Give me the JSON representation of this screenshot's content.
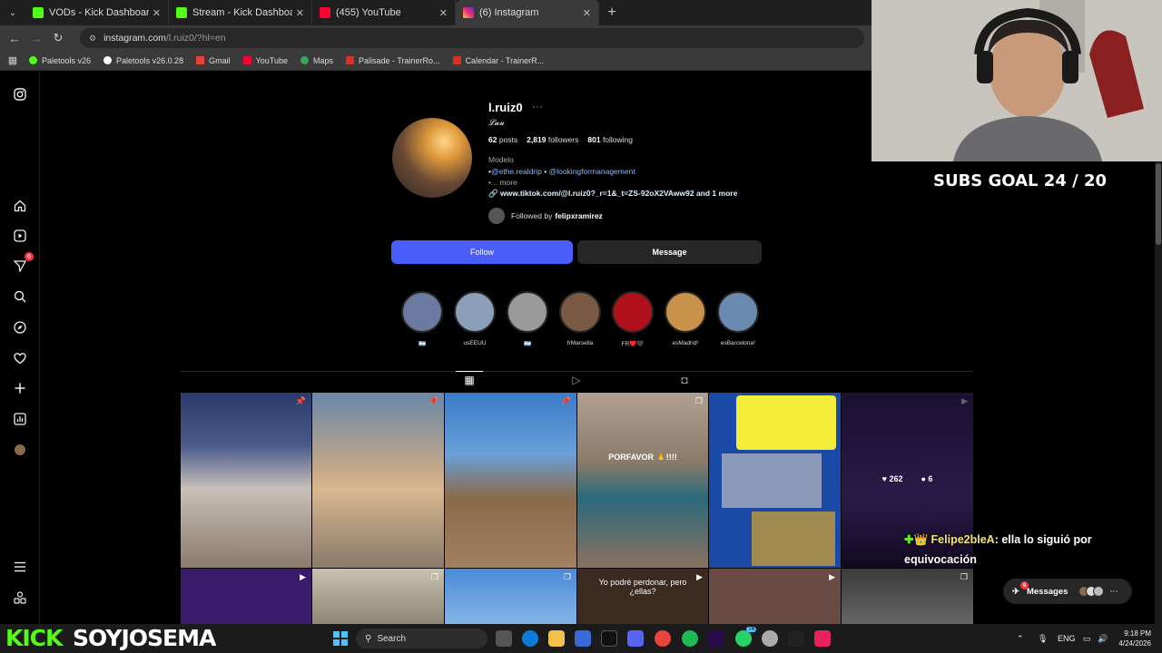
{
  "browser": {
    "tabs": [
      {
        "label": "VODs - Kick Dashboard",
        "icon": "kick"
      },
      {
        "label": "Stream - Kick Dashboard",
        "icon": "kick"
      },
      {
        "label": "(455) YouTube",
        "icon": "yt"
      },
      {
        "label": "(6) Instagram",
        "icon": "ig"
      }
    ],
    "url": {
      "domain": "instagram.com",
      "path": "/l.ruiz0/?hl=en"
    },
    "bookmarks": [
      {
        "label": "Paletools v26",
        "color": "#53fc18"
      },
      {
        "label": "Paletools v26.0.28",
        "color": "#ffffff"
      },
      {
        "label": "Gmail",
        "color": "#ea4335"
      },
      {
        "label": "YouTube",
        "color": "#ff0033"
      },
      {
        "label": "Maps",
        "color": "#34a853"
      },
      {
        "label": "Palisade - TrainerRo...",
        "color": "#d93025"
      },
      {
        "label": "Calendar - TrainerR...",
        "color": "#d93025"
      }
    ]
  },
  "instagram": {
    "sidebar": {
      "notifications_badge": "6"
    },
    "profile": {
      "username": "l.ruiz0",
      "more": "···",
      "full_name": "𝓛𝓪𝓾",
      "stats": {
        "posts": {
          "value": "62",
          "label": "posts"
        },
        "followers": {
          "value": "2,819",
          "label": "followers"
        },
        "following": {
          "value": "801",
          "label": "following"
        }
      },
      "bio_category": "Modelo",
      "bio_tag1": "@ethe.realdrip",
      "bio_tag2": "@lookingformanagement",
      "bio_more": "... more",
      "bio_link": "www.tiktok.com/@l.ruiz0?_r=1&_t=ZS-92oX2VAww92 and 1 more",
      "followed_by_prefix": "Followed by",
      "followed_by_user": "felipxramirez"
    },
    "buttons": {
      "follow": "Follow",
      "message": "Message"
    },
    "highlights": [
      {
        "label": "🇦🇷",
        "color": "#6a7aa0"
      },
      {
        "label": "usEEUU",
        "color": "#8aa0b8"
      },
      {
        "label": "🇦🇷",
        "color": "#9a9a9a"
      },
      {
        "label": "frMarsella",
        "color": "#7a5a44"
      },
      {
        "label": "FR♥️🖤",
        "color": "#b0101a"
      },
      {
        "label": "esMadrid²",
        "color": "#c8924a"
      },
      {
        "label": "esBarcelona²",
        "color": "#6a8ab0"
      }
    ],
    "grid": {
      "caption_porfavor": "PORFAVOR 🙏!!!!",
      "caption_perdonar": "Yo podré perdonar, pero ¿ellas?",
      "likes": "262",
      "comments": "6"
    }
  },
  "overlay": {
    "subs_goal": "SUBS GOAL 24 / 20",
    "chat_user": "Felipe2bleA",
    "chat_text": ": ella lo siguió por equivocación"
  },
  "messages_pill": {
    "label": "Messages",
    "badge": "6"
  },
  "taskbar": {
    "brand": "KICK",
    "channel": "SOYJOSEMA",
    "search": "Search",
    "lang": "ENG",
    "time": "9:18 PM",
    "date": "4/24/2026",
    "badge_whatsapp": "74"
  }
}
